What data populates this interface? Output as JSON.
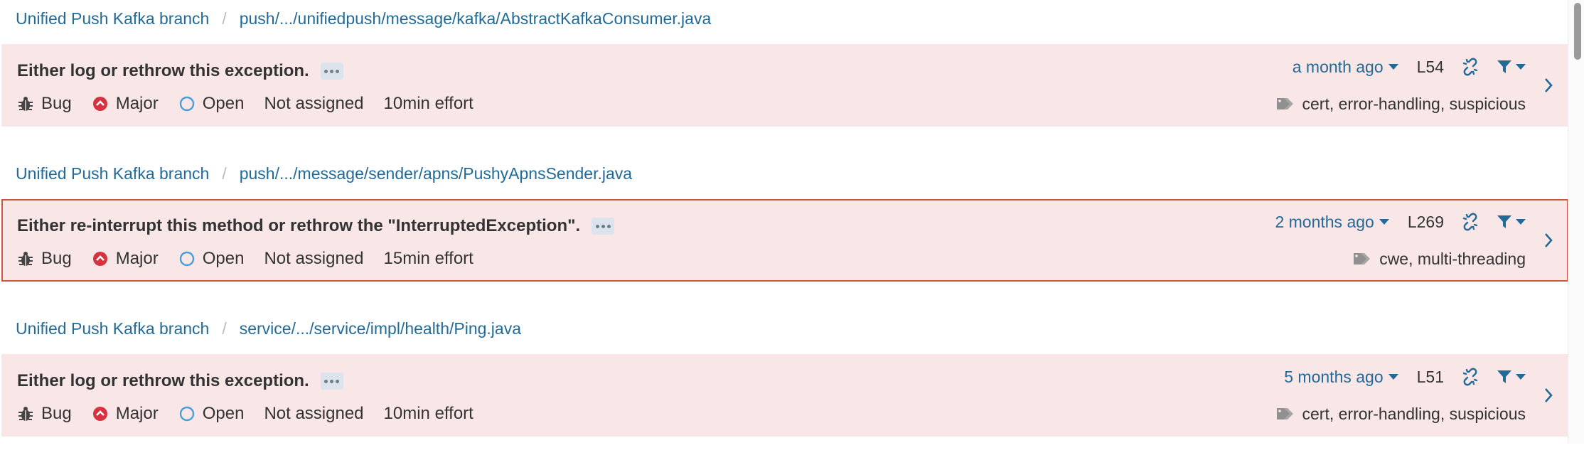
{
  "issues": [
    {
      "project": "Unified Push Kafka branch",
      "path": "push/.../unifiedpush/message/kafka/AbstractKafkaConsumer.java",
      "message": "Either log or rethrow this exception.",
      "type": "Bug",
      "severity": "Major",
      "status": "Open",
      "assignee": "Not assigned",
      "effort": "10min effort",
      "date": "a month ago",
      "line": "L54",
      "tags": "cert, error-handling, suspicious",
      "selected": false
    },
    {
      "project": "Unified Push Kafka branch",
      "path": "push/.../message/sender/apns/PushyApnsSender.java",
      "message": "Either re-interrupt this method or rethrow the \"InterruptedException\".",
      "type": "Bug",
      "severity": "Major",
      "status": "Open",
      "assignee": "Not assigned",
      "effort": "15min effort",
      "date": "2 months ago",
      "line": "L269",
      "tags": "cwe, multi-threading",
      "selected": true
    },
    {
      "project": "Unified Push Kafka branch",
      "path": "service/.../service/impl/health/Ping.java",
      "message": "Either log or rethrow this exception.",
      "type": "Bug",
      "severity": "Major",
      "status": "Open",
      "assignee": "Not assigned",
      "effort": "10min effort",
      "date": "5 months ago",
      "line": "L51",
      "tags": "cert, error-handling, suspicious",
      "selected": false
    }
  ],
  "icons": {
    "type": "bug-icon",
    "severity": "major-severity-icon",
    "status": "open-status-icon",
    "link": "unlink-icon",
    "filter": "filter-icon",
    "tags": "tag-icon",
    "open": "chevron-right-icon",
    "more": "more-icon"
  },
  "colors": {
    "link": "#236a97",
    "issue_background": "#f9e7e7",
    "selected_border": "#d0533f",
    "severity_major": "#d4333f",
    "status_open": "#4b9fd5"
  }
}
